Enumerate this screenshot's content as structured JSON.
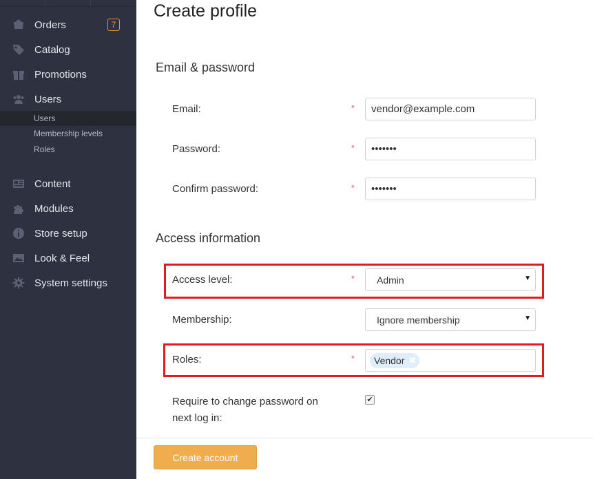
{
  "sidebar": {
    "items": [
      {
        "label": "Orders",
        "icon": "orders-icon",
        "badge": "7"
      },
      {
        "label": "Catalog",
        "icon": "tag-icon"
      },
      {
        "label": "Promotions",
        "icon": "gift-icon"
      },
      {
        "label": "Users",
        "icon": "users-icon"
      },
      {
        "label": "Content",
        "icon": "content-icon"
      },
      {
        "label": "Modules",
        "icon": "puzzle-icon"
      },
      {
        "label": "Store setup",
        "icon": "info-icon"
      },
      {
        "label": "Look & Feel",
        "icon": "image-icon"
      },
      {
        "label": "System settings",
        "icon": "gear-icon"
      }
    ],
    "users_sub": [
      {
        "label": "Users",
        "active": true
      },
      {
        "label": "Membership levels"
      },
      {
        "label": "Roles"
      }
    ]
  },
  "main": {
    "title": "Create profile",
    "sections": {
      "email_password": "Email & password",
      "access_info": "Access information"
    },
    "fields": {
      "email": {
        "label": "Email:",
        "value": "vendor@example.com"
      },
      "password": {
        "label": "Password:",
        "value": "•••••••"
      },
      "confirm": {
        "label": "Confirm password:",
        "value": "•••••••"
      },
      "access_level": {
        "label": "Access level:",
        "value": "Admin"
      },
      "membership": {
        "label": "Membership:",
        "value": "Ignore membership"
      },
      "roles": {
        "label": "Roles:",
        "tag": "Vendor"
      },
      "require_change": {
        "label_line1": "Require to change password on",
        "label_line2": "next log in:",
        "checked": true
      }
    },
    "required_mark": "*",
    "tag_remove": "✖",
    "checkbox_mark": "✔",
    "submit_label": "Create account"
  },
  "colors": {
    "sidebar_bg": "#2e3140",
    "accent": "#f0ad4e",
    "badge": "#e8962e",
    "highlight": "#e11b22"
  }
}
